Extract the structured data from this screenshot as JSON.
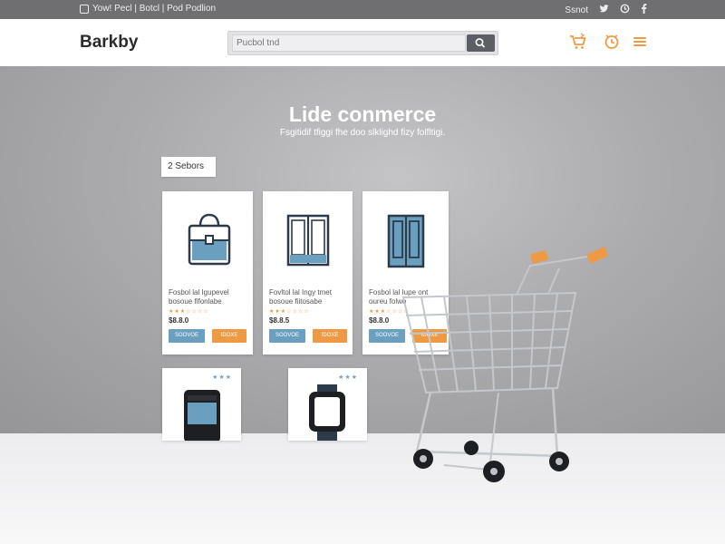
{
  "topbar": {
    "left_text": "Yow! Pecl | Botcl | Pod Podlion",
    "signin": "Ssnot",
    "social_icons": [
      "twitter-icon",
      "circle-icon",
      "facebook-icon"
    ]
  },
  "header": {
    "logo": "Barkby",
    "search_placeholder": "Pucbol tnd",
    "icons": [
      "cart-icon",
      "clock-icon",
      "menu-icon"
    ]
  },
  "hero": {
    "title": "Lide conmerce",
    "subtitle": "Fsgitidif tfiggi fhe doo slklighd fizy folfltigi.",
    "filter_label": "2 Sebors"
  },
  "products": [
    {
      "icon": "handbag-icon",
      "name": "Fosbol lal Igupevel bosoue fifonlabe",
      "stars": "★★★☆☆☆☆",
      "price": "$8.8.0",
      "btn1": "SOOVOE",
      "btn2": "IDOXE"
    },
    {
      "icon": "window-frame-icon",
      "name": "Fovltol lal Ingy tmet bosoue fiitosabe",
      "stars": "★★★☆☆☆☆",
      "price": "$8.8.5",
      "btn1": "SOOVOE",
      "btn2": "IDOXE"
    },
    {
      "icon": "wardrobe-icon",
      "name": "Fosbol lal Iupe ont oureu folwo",
      "stars": "★★★☆☆☆☆",
      "price": "$8.8.0",
      "btn1": "SOOVOE",
      "btn2": "IDOXE"
    },
    {
      "icon": "smartphone-icon",
      "mini_stars": "★★★"
    },
    {
      "icon": "smartwatch-icon",
      "mini_stars": "★★★"
    }
  ],
  "colors": {
    "accent_orange": "#ee9a45",
    "accent_blue": "#6a9fc0",
    "topbar": "#6f6f71"
  }
}
